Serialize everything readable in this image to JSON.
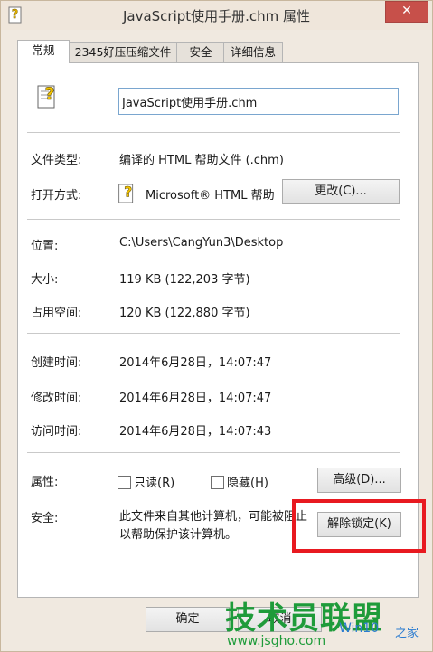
{
  "window": {
    "title": "JavaScript使用手册.chm 属性",
    "close_glyph": "✕"
  },
  "tabs": [
    {
      "label": "常规",
      "active": true
    },
    {
      "label": "2345好压压缩文件",
      "active": false
    },
    {
      "label": "安全",
      "active": false
    },
    {
      "label": "详细信息",
      "active": false
    }
  ],
  "general": {
    "file_name": "JavaScript使用手册.chm",
    "file_type_label": "文件类型:",
    "file_type_value": "编译的 HTML 帮助文件 (.chm)",
    "open_with_label": "打开方式:",
    "open_with_value": "Microsoft® HTML 帮助",
    "change_button": "更改(C)...",
    "location_label": "位置:",
    "location_value": "C:\\Users\\CangYun3\\Desktop",
    "size_label": "大小:",
    "size_value": "119 KB (122,203 字节)",
    "disk_size_label": "占用空间:",
    "disk_size_value": "120 KB (122,880 字节)",
    "created_label": "创建时间:",
    "created_value": "2014年6月28日，14:07:47",
    "modified_label": "修改时间:",
    "modified_value": "2014年6月28日，14:07:47",
    "accessed_label": "访问时间:",
    "accessed_value": "2014年6月28日，14:07:43",
    "attributes_label": "属性:",
    "readonly_label": "只读(R)",
    "readonly_checked": false,
    "hidden_label": "隐藏(H)",
    "hidden_checked": false,
    "advanced_button": "高级(D)...",
    "security_label": "安全:",
    "security_text_line1": "此文件来自其他计算机，可能被阻止",
    "security_text_line2": "以帮助保护该计算机。",
    "unblock_button": "解除锁定(K)"
  },
  "footer": {
    "ok_button": "确定",
    "cancel_button": "取消"
  },
  "watermark": {
    "main": "技术员联盟",
    "url": "www.jsgho.com",
    "win_text": "Win10",
    "home_text": "之家"
  },
  "colors": {
    "highlight": "#e81920",
    "watermark_green": "#1e9b3a"
  }
}
